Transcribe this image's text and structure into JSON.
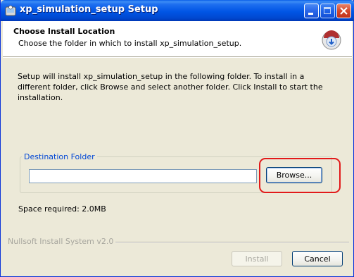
{
  "window": {
    "title": "xp_simulation_setup Setup"
  },
  "header": {
    "title": "Choose Install Location",
    "subtitle": "Choose the folder in which to install xp_simulation_setup."
  },
  "body": {
    "description": "Setup will install xp_simulation_setup in the following folder. To install in a different folder, click Browse and select another folder. Click Install to start the installation.",
    "destination_label": "Destination Folder",
    "destination_value": "",
    "browse_label": "Browse...",
    "space_required": "Space required: 2.0MB"
  },
  "footer": {
    "branding": "Nullsoft Install System v2.0",
    "install_label": "Install",
    "cancel_label": "Cancel"
  },
  "icons": {
    "app": "installer-icon",
    "header": "install-disc-icon"
  },
  "colors": {
    "titlebar": "#0055e5",
    "highlight": "#e21a1a",
    "group_label": "#0046d5"
  }
}
